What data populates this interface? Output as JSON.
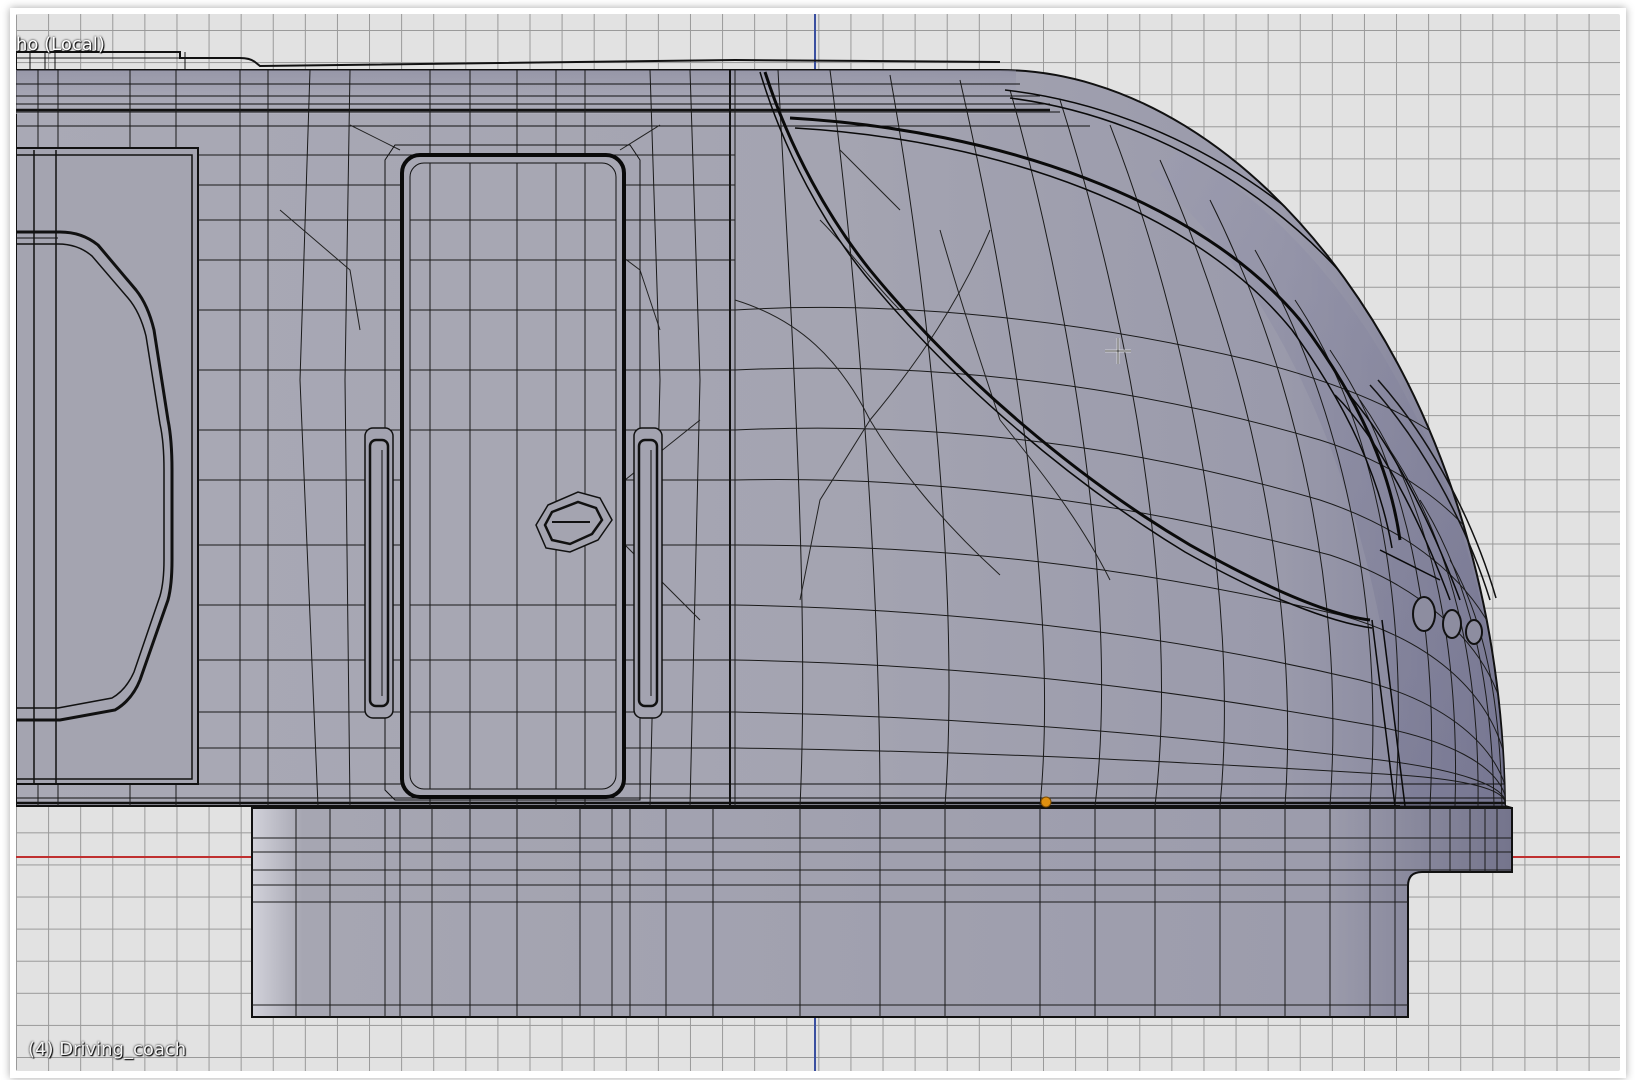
{
  "viewport": {
    "view_label": "ho (Local)",
    "object_label": "(4) Driving_coach",
    "cursor": "crosshair-cursor"
  },
  "colors": {
    "grid_background": "#e2e2e2",
    "grid_line": "#999999",
    "axis_x": "#c03030",
    "axis_z": "#3a4fa0",
    "mesh_surface": "#a3a3b0",
    "mesh_shadow": "#6e6e82",
    "wire": "#111111",
    "origin": "#e09010"
  }
}
